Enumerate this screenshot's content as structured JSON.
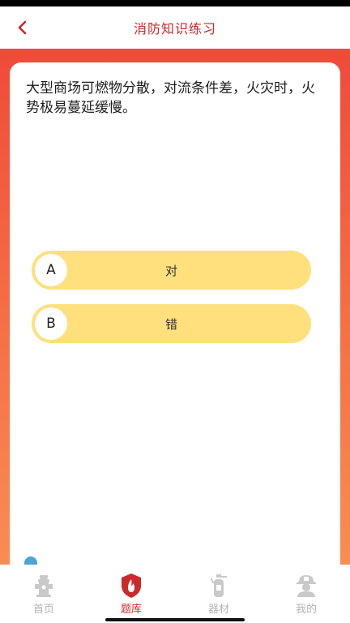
{
  "header": {
    "title": "消防知识练习",
    "back_icon": "chevron-left-icon"
  },
  "question": {
    "text": "大型商场可燃物分散，对流条件差，火灾时，火势极易蔓延缓慢。"
  },
  "options": [
    {
      "letter": "A",
      "text": "对"
    },
    {
      "letter": "B",
      "text": "错"
    }
  ],
  "tabbar": {
    "items": [
      {
        "label": "首页",
        "icon": "fire-hydrant-icon",
        "active": false
      },
      {
        "label": "题库",
        "icon": "flame-shield-icon",
        "active": true
      },
      {
        "label": "器材",
        "icon": "fire-extinguisher-icon",
        "active": false
      },
      {
        "label": "我的",
        "icon": "firefighter-icon",
        "active": false
      }
    ]
  },
  "colors": {
    "accent": "#c8282a",
    "option_bg": "#ffe07d",
    "gradient_top": "#f04a3a",
    "gradient_bottom": "#f98d52",
    "inactive": "#b5b5b5"
  }
}
